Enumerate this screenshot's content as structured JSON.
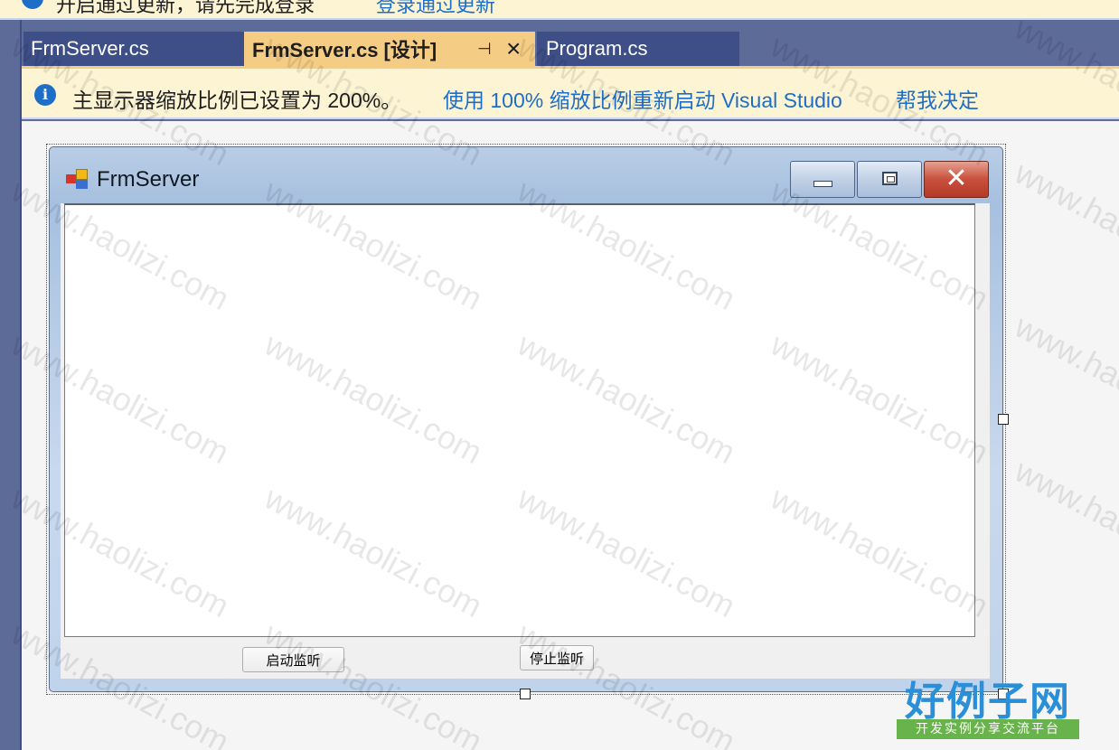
{
  "notification_top": {
    "message": "开启通过更新，请先完成登录",
    "link": "登录通过更新"
  },
  "tabs": [
    {
      "label": "FrmServer.cs",
      "active": false
    },
    {
      "label": "FrmServer.cs [设计]",
      "active": true
    },
    {
      "label": "Program.cs",
      "active": false
    }
  ],
  "tab_icons": {
    "pin": "pin-icon",
    "close": "close-icon"
  },
  "info_bar": {
    "icon": "info-icon",
    "message": "主显示器缩放比例已设置为 200%。",
    "link_restart": "使用 100% 缩放比例重新启动 Visual Studio",
    "link_decide": "帮我决定"
  },
  "form": {
    "title": "FrmServer",
    "caption_buttons": [
      "minimize-icon",
      "maximize-icon",
      "close-icon"
    ],
    "close_glyph": "✕",
    "buttons": {
      "start": "启动监听",
      "stop": "停止监听"
    }
  },
  "watermark": {
    "text": "www.haolizi.com"
  },
  "site_logo": {
    "main": "好例子网",
    "tagline": "开发实例分享交流平台"
  },
  "colors": {
    "chrome": "#5d6b99",
    "active_tab": "#f5cc84",
    "inactive_tab": "#3e4f87",
    "info_bar": "#fdf4d4",
    "link": "#1e6ec8"
  }
}
